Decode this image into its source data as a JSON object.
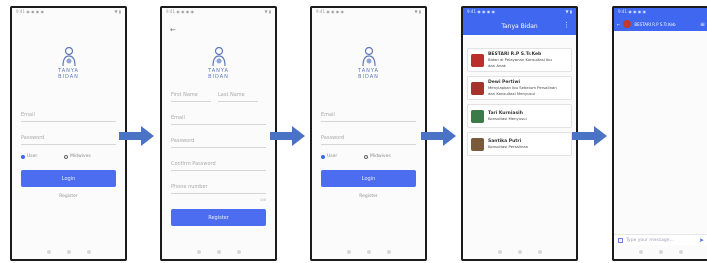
{
  "logo": {
    "line1": "TANYA",
    "line2": "BIDAN"
  },
  "login": {
    "email": "Email",
    "password": "Password",
    "radio_user": "User",
    "radio_midwife": "Midwives",
    "login_button": "Login",
    "register_link": "Register"
  },
  "register": {
    "first_name": "First Name",
    "last_name": "Last Name",
    "email": "Email",
    "password": "Password",
    "confirm_password": "Confirm Password",
    "phone": "Phone number",
    "counter": "0/0",
    "register_button": "Register"
  },
  "chatlist": {
    "title": "Tanya Bidan",
    "menu_glyph": "⋮",
    "items": [
      {
        "title": "BESTARI R.P S.Tr.Keb",
        "line1": "Bidan di Pelayanan Konsultasi Ibu",
        "line2": "dan Anak",
        "color": "#b9302a"
      },
      {
        "title": "Dewi Pertiwi",
        "line1": "Menyiapkan Ibu Sebelum Persalinan",
        "line2": "dan Konsultasi Menyusui",
        "color": "#a6322d"
      },
      {
        "title": "Tari Kurniasih",
        "line1": "Konsultasi Menyusui",
        "line2": "",
        "color": "#3b7b4a"
      },
      {
        "title": "Santika Putri",
        "line1": "Konsultasi Persalinan",
        "line2": "",
        "color": "#7a5a3a"
      }
    ]
  },
  "chat": {
    "contact": "BESTARI R.P S.Tr.Keb",
    "menu_glyph": "≡",
    "input_placeholder": "Type your message...",
    "send_glyph": "➤"
  },
  "status": {
    "left": "9:41 ◉ ◉ ◉ ◉",
    "right": "▼ ▮"
  },
  "colors": {
    "primary": "#3f67f0",
    "arrow": "#4a73c5"
  }
}
